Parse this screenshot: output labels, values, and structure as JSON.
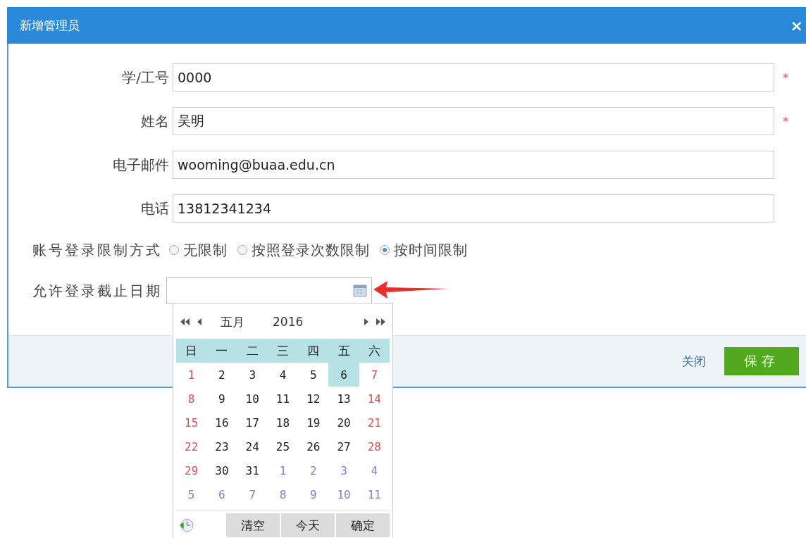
{
  "dialog": {
    "title": "新增管理员",
    "close": "×"
  },
  "fields": [
    {
      "label": "学/工号",
      "value": "0000",
      "required": true,
      "required_mark": "*"
    },
    {
      "label": "姓名",
      "value": "吴明",
      "required": true,
      "required_mark": "*"
    },
    {
      "label": "电子邮件",
      "value": "wooming@buaa.edu.cn",
      "required": false
    },
    {
      "label": "电话",
      "value": "13812341234",
      "required": false
    }
  ],
  "login_limit": {
    "label": "账号登录限制方式",
    "options": [
      {
        "label": "无限制",
        "selected": false
      },
      {
        "label": "按照登录次数限制",
        "selected": false
      },
      {
        "label": "按时间限制",
        "selected": true
      }
    ]
  },
  "deadline": {
    "label": "允许登录截止日期"
  },
  "footer": {
    "close": "关闭",
    "save": "保存"
  },
  "calendar": {
    "month": "五月",
    "year": "2016",
    "weekdays": [
      "日",
      "一",
      "二",
      "三",
      "四",
      "五",
      "六"
    ],
    "weeks": [
      [
        {
          "day": "1",
          "kind": "weekend",
          "selected": false
        },
        {
          "day": "2",
          "kind": "weekday",
          "selected": false
        },
        {
          "day": "3",
          "kind": "weekday",
          "selected": false
        },
        {
          "day": "4",
          "kind": "weekday",
          "selected": false
        },
        {
          "day": "5",
          "kind": "weekday",
          "selected": false
        },
        {
          "day": "6",
          "kind": "weekday",
          "selected": true
        },
        {
          "day": "7",
          "kind": "weekend",
          "selected": false
        }
      ],
      [
        {
          "day": "8",
          "kind": "weekend",
          "selected": false
        },
        {
          "day": "9",
          "kind": "weekday",
          "selected": false
        },
        {
          "day": "10",
          "kind": "weekday",
          "selected": false
        },
        {
          "day": "11",
          "kind": "weekday",
          "selected": false
        },
        {
          "day": "12",
          "kind": "weekday",
          "selected": false
        },
        {
          "day": "13",
          "kind": "weekday",
          "selected": false
        },
        {
          "day": "14",
          "kind": "weekend",
          "selected": false
        }
      ],
      [
        {
          "day": "15",
          "kind": "weekend",
          "selected": false
        },
        {
          "day": "16",
          "kind": "weekday",
          "selected": false
        },
        {
          "day": "17",
          "kind": "weekday",
          "selected": false
        },
        {
          "day": "18",
          "kind": "weekday",
          "selected": false
        },
        {
          "day": "19",
          "kind": "weekday",
          "selected": false
        },
        {
          "day": "20",
          "kind": "weekday",
          "selected": false
        },
        {
          "day": "21",
          "kind": "weekend",
          "selected": false
        }
      ],
      [
        {
          "day": "22",
          "kind": "weekend",
          "selected": false
        },
        {
          "day": "23",
          "kind": "weekday",
          "selected": false
        },
        {
          "day": "24",
          "kind": "weekday",
          "selected": false
        },
        {
          "day": "25",
          "kind": "weekday",
          "selected": false
        },
        {
          "day": "26",
          "kind": "weekday",
          "selected": false
        },
        {
          "day": "27",
          "kind": "weekday",
          "selected": false
        },
        {
          "day": "28",
          "kind": "weekend",
          "selected": false
        }
      ],
      [
        {
          "day": "29",
          "kind": "weekend",
          "selected": false
        },
        {
          "day": "30",
          "kind": "weekday",
          "selected": false
        },
        {
          "day": "31",
          "kind": "weekday",
          "selected": false
        },
        {
          "day": "1",
          "kind": "other",
          "selected": false
        },
        {
          "day": "2",
          "kind": "other",
          "selected": false
        },
        {
          "day": "3",
          "kind": "other",
          "selected": false
        },
        {
          "day": "4",
          "kind": "other",
          "selected": false
        }
      ],
      [
        {
          "day": "5",
          "kind": "other",
          "selected": false
        },
        {
          "day": "6",
          "kind": "other",
          "selected": false
        },
        {
          "day": "7",
          "kind": "other",
          "selected": false
        },
        {
          "day": "8",
          "kind": "other",
          "selected": false
        },
        {
          "day": "9",
          "kind": "other",
          "selected": false
        },
        {
          "day": "10",
          "kind": "other",
          "selected": false
        },
        {
          "day": "11",
          "kind": "other",
          "selected": false
        }
      ]
    ],
    "buttons": [
      "清空",
      "今天",
      "确定"
    ]
  }
}
